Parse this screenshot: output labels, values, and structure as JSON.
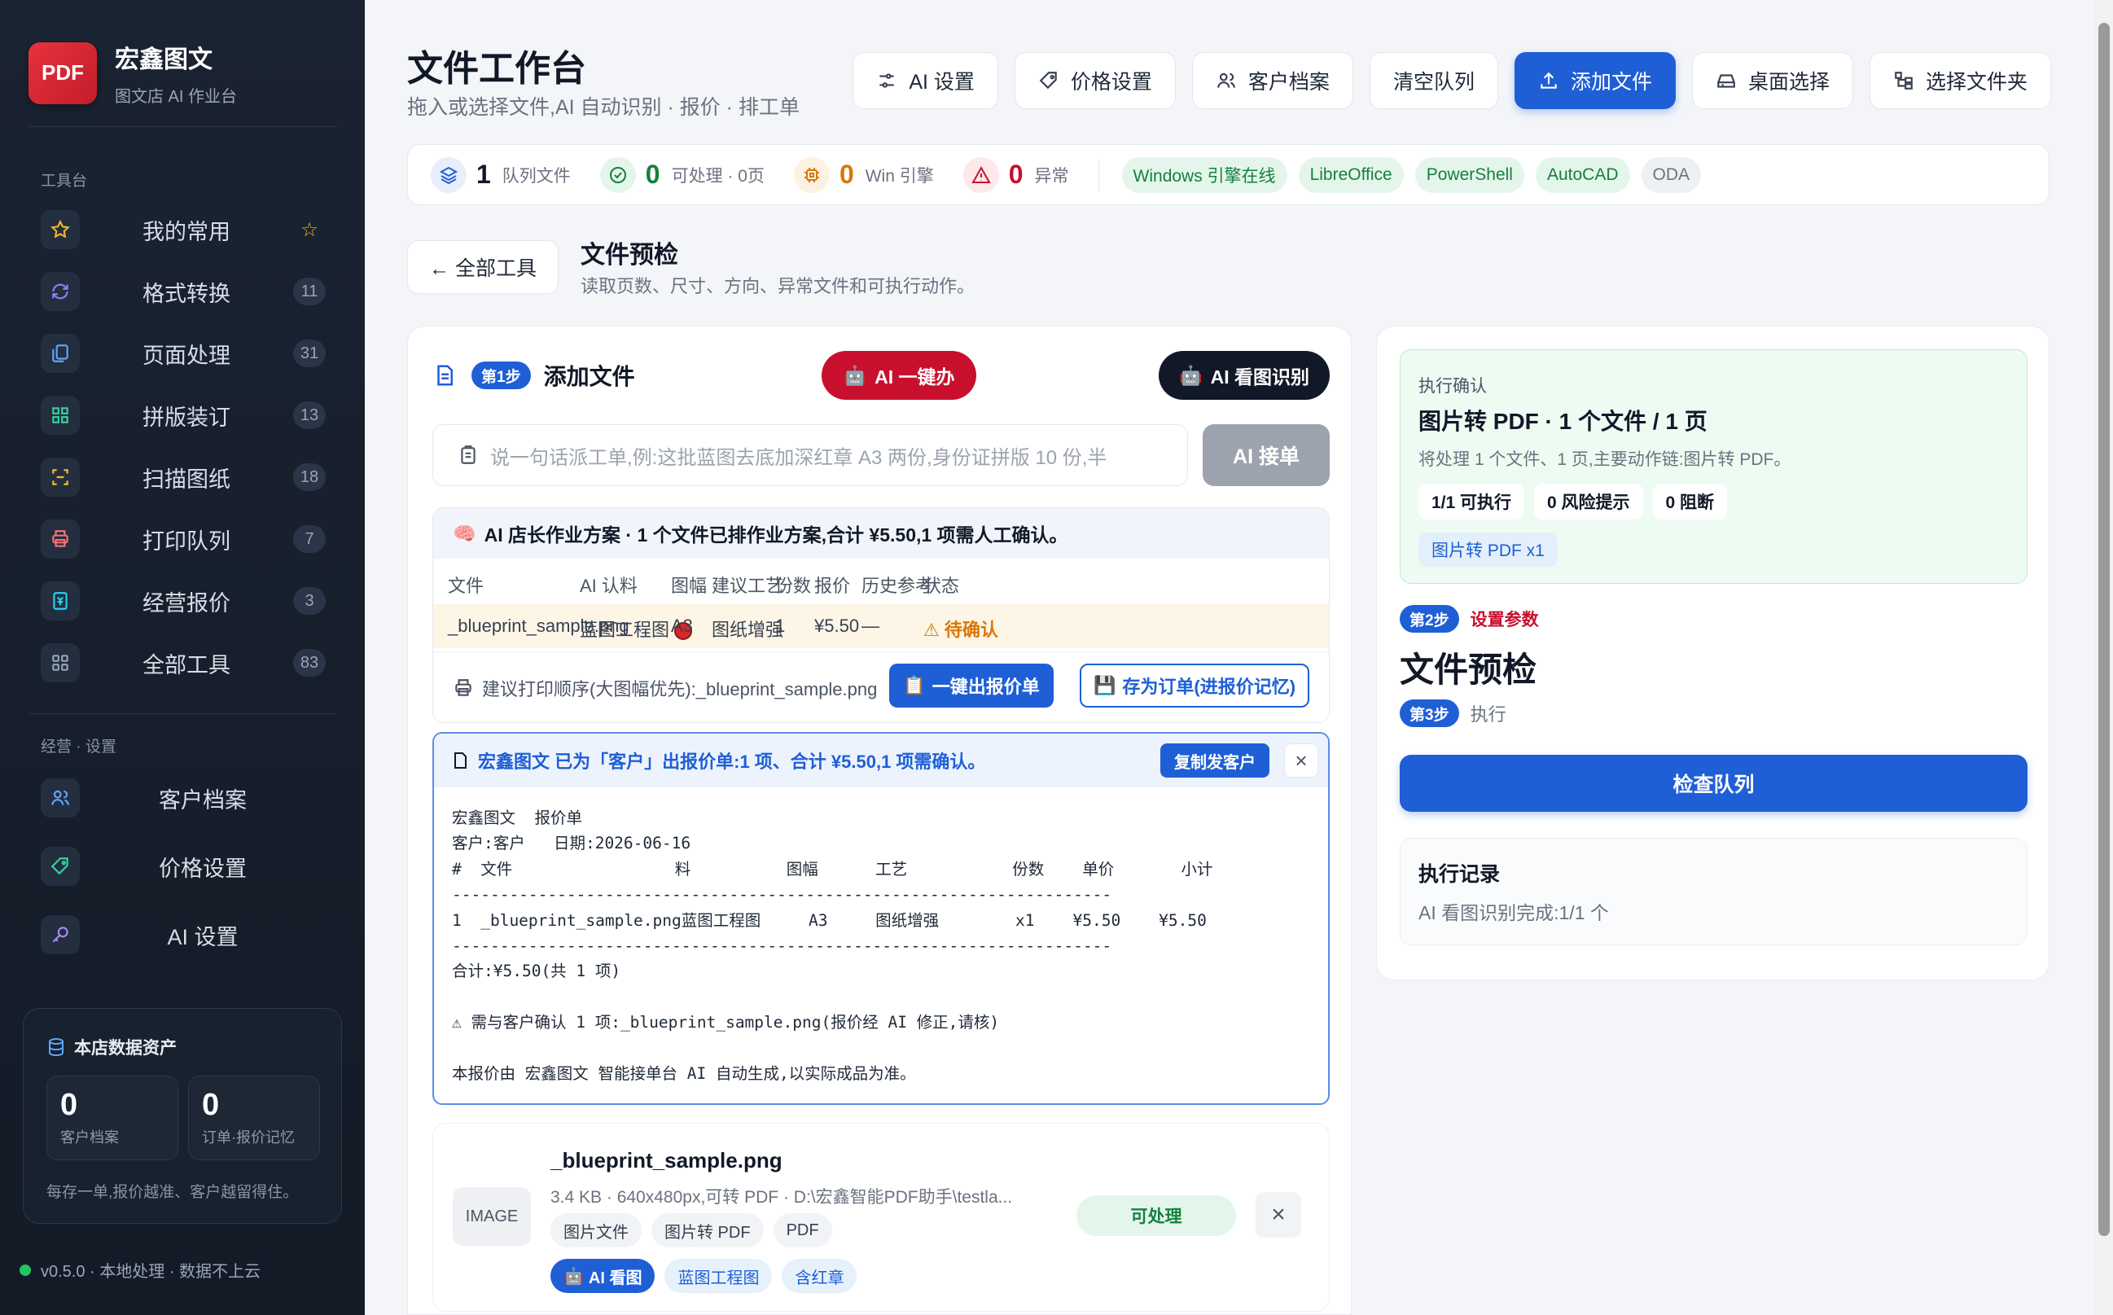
{
  "brand": {
    "logo": "PDF",
    "name": "宏鑫图文",
    "subtitle": "图文店 AI 作业台"
  },
  "sidebar": {
    "section_tools": "工具台",
    "items": [
      {
        "icon": "star-icon",
        "label": "我的常用",
        "badge": "☆"
      },
      {
        "icon": "refresh-icon",
        "label": "格式转换",
        "badge": "11"
      },
      {
        "icon": "pages-icon",
        "label": "页面处理",
        "badge": "31"
      },
      {
        "icon": "grid-icon",
        "label": "拼版装订",
        "badge": "13"
      },
      {
        "icon": "scan-icon",
        "label": "扫描图纸",
        "badge": "18"
      },
      {
        "icon": "printer-icon",
        "label": "打印队列",
        "badge": "7"
      },
      {
        "icon": "price-icon",
        "label": "经营报价",
        "badge": "3"
      },
      {
        "icon": "apps-icon",
        "label": "全部工具",
        "badge": "83"
      }
    ],
    "section_business": "经营 · 设置",
    "settings": [
      {
        "icon": "users-icon",
        "label": "客户档案"
      },
      {
        "icon": "tag-icon",
        "label": "价格设置"
      },
      {
        "icon": "key-icon",
        "label": "AI 设置"
      }
    ],
    "assets": {
      "title": "本店数据资产",
      "customers": {
        "value": "0",
        "label": "客户档案"
      },
      "orders": {
        "value": "0",
        "label": "订单·报价记忆"
      },
      "footer": "每存一单,报价越准、客户越留得住。"
    },
    "version": "v0.5.0 · 本地处理 · 数据不上云"
  },
  "header": {
    "title": "文件工作台",
    "subtitle": "拖入或选择文件,AI 自动识别 · 报价 · 排工单",
    "buttons": [
      {
        "icon": "sliders-icon",
        "label": "AI 设置"
      },
      {
        "icon": "tag-icon",
        "label": "价格设置"
      },
      {
        "icon": "users-icon",
        "label": "客户档案"
      },
      {
        "icon": "",
        "label": "清空队列"
      },
      {
        "icon": "upload-icon",
        "label": "添加文件"
      },
      {
        "icon": "drive-icon",
        "label": "桌面选择"
      },
      {
        "icon": "folder-tree-icon",
        "label": "选择文件夹"
      }
    ]
  },
  "stats": {
    "queue": {
      "value": "1",
      "label": "队列文件"
    },
    "ready": {
      "value": "0",
      "label": "可处理 · 0页"
    },
    "engine": {
      "value": "0",
      "label": "Win 引擎"
    },
    "error": {
      "value": "0",
      "label": "异常"
    },
    "engines": [
      "Windows 引擎在线",
      "LibreOffice",
      "PowerShell",
      "AutoCAD",
      "ODA"
    ]
  },
  "section": {
    "back": "← 全部工具",
    "title": "文件预检",
    "subtitle": "读取页数、尺寸、方向、异常文件和可执行动作。"
  },
  "step1": {
    "badge": "第1步",
    "title": "添加文件",
    "ai_one_click": "AI 一键办",
    "ai_vision": "AI 看图识别",
    "input_placeholder": "说一句话派工单,例:这批蓝图去底加深红章 A3 两份,身份证拼版 10 份,半",
    "send": "AI 接单"
  },
  "plan": {
    "header": "AI 店长作业方案 · 1 个文件已排作业方案,合计 ¥5.50,1 项需人工确认。",
    "columns": [
      "文件",
      "AI 认料",
      "图幅",
      "建议工艺",
      "份数",
      "报价",
      "历史参考",
      "状态"
    ],
    "row": [
      "_blueprint_sample.png",
      "蓝图工程图",
      "A3",
      "图纸增强",
      "1",
      "¥5.50",
      "—",
      "⚠ 待确认"
    ],
    "print_order": "建议打印顺序(大图幅优先):_blueprint_sample.png",
    "quote_btn": "一键出报价单",
    "save_btn": "存为订单(进报价记忆)"
  },
  "quote": {
    "header": "宏鑫图文 已为「客户」出报价单:1 项、合计 ¥5.50,1 项需确认。",
    "copy": "复制发客户",
    "body": "宏鑫图文  报价单\n客户:客户   日期:2026-06-16\n#  文件                 料          图幅      工艺           份数    单价       小计\n---------------------------------------------------------------------\n1  _blueprint_sample.png蓝图工程图     A3     图纸增强        x1    ¥5.50    ¥5.50\n---------------------------------------------------------------------\n合计:¥5.50(共 1 项)\n\n⚠ 需与客户确认 1 项:_blueprint_sample.png(报价经 AI 修正,请核)\n\n本报价由 宏鑫图文 智能接单台 AI 自动生成,以实际成品为准。"
  },
  "file": {
    "thumb": "IMAGE",
    "name": "_blueprint_sample.png",
    "meta": "3.4 KB · 640x480px,可转 PDF · D:\\宏鑫智能PDF助手\\testla...",
    "tags": [
      "图片文件",
      "图片转 PDF",
      "PDF"
    ],
    "ai_tags": [
      "AI 看图",
      "蓝图工程图",
      "含红章"
    ],
    "status": "可处理"
  },
  "confirm": {
    "label": "执行确认",
    "title": "图片转 PDF · 1 个文件 / 1 页",
    "desc": "将处理 1 个文件、1 页,主要动作链:图片转 PDF。",
    "pills": [
      "1/1 可执行",
      "0 风险提示",
      "0 阻断"
    ],
    "chip": "图片转 PDF x1"
  },
  "step2": {
    "badge": "第2步",
    "label": "设置参数"
  },
  "tool_title": "文件预检",
  "step3": {
    "badge": "第3步",
    "label": "执行"
  },
  "check_btn": "检查队列",
  "log": {
    "title": "执行记录",
    "text": "AI 看图识别完成:1/1 个"
  },
  "colors": {
    "primary": "#1f5fd6",
    "danger": "#c8102e",
    "success": "#15803d",
    "sidebar": "#1a2332"
  }
}
